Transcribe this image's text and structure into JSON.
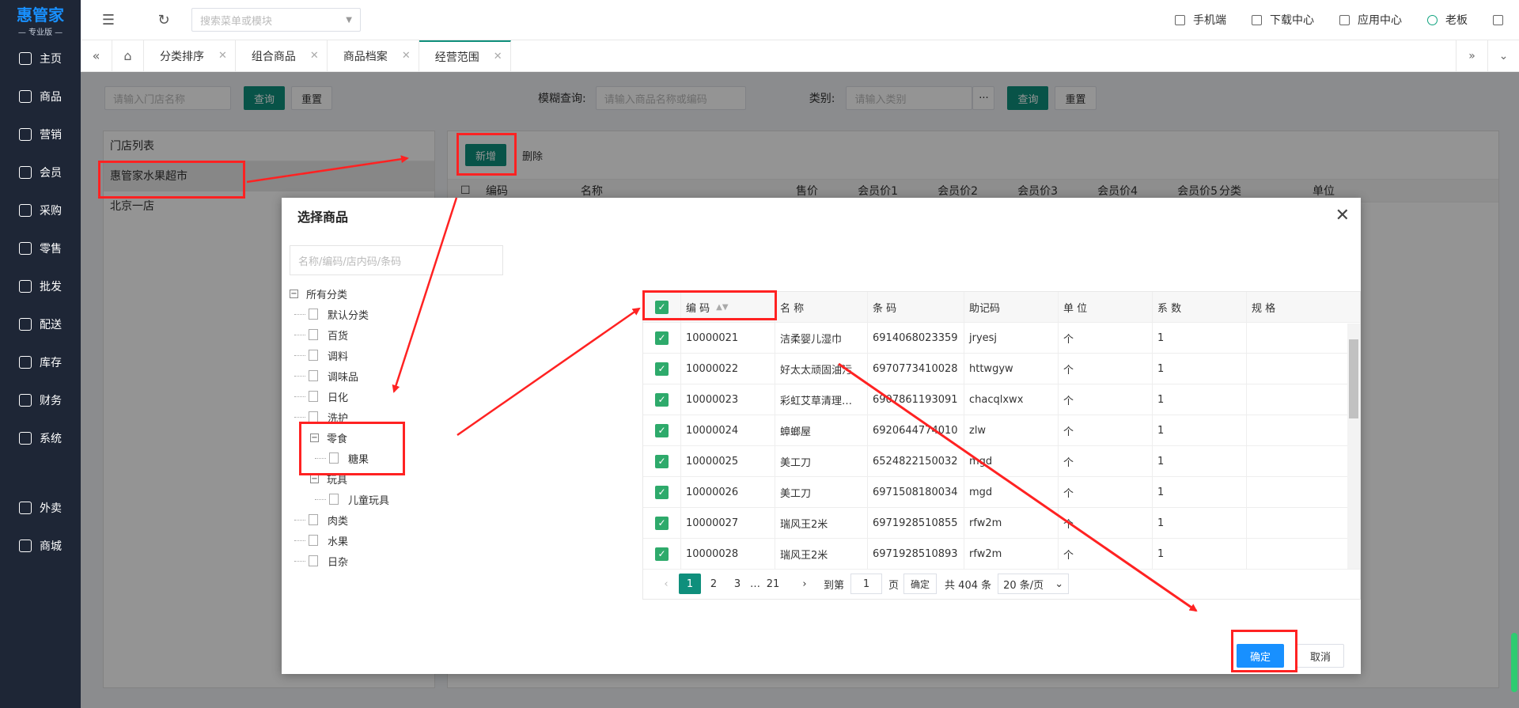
{
  "brand": {
    "name": "惠管家",
    "edition": "— 专业版 —",
    "color": "#1890ff"
  },
  "sidebar": {
    "items": [
      {
        "label": "主页",
        "icon": "home-icon"
      },
      {
        "label": "商品",
        "icon": "box-icon"
      },
      {
        "label": "营销",
        "icon": "chart-icon"
      },
      {
        "label": "会员",
        "icon": "heart-icon"
      },
      {
        "label": "采购",
        "icon": "cart-icon"
      },
      {
        "label": "零售",
        "icon": "bag-icon"
      },
      {
        "label": "批发",
        "icon": "stack-icon"
      },
      {
        "label": "配送",
        "icon": "truck-icon"
      },
      {
        "label": "库存",
        "icon": "warehouse-icon"
      },
      {
        "label": "财务",
        "icon": "finance-icon"
      },
      {
        "label": "系统",
        "icon": "settings-icon"
      },
      {
        "label": "外卖",
        "icon": "delivery-icon"
      },
      {
        "label": "商城",
        "icon": "shop-icon"
      }
    ]
  },
  "topbar": {
    "search_placeholder": "搜索菜单或模块",
    "mobile": "手机端",
    "download": "下载中心",
    "apps": "应用中心",
    "user": "老板"
  },
  "tabs": [
    {
      "label": "分类排序"
    },
    {
      "label": "组合商品"
    },
    {
      "label": "商品档案"
    },
    {
      "label": "经营范围",
      "active": true
    }
  ],
  "filters": {
    "store_placeholder": "请输入门店名称",
    "query": "查询",
    "reset": "重置",
    "fuzzy_label": "模糊查询:",
    "fuzzy_placeholder": "请输入商品名称或编码",
    "category_label": "类别:",
    "category_placeholder": "请输入类别",
    "more": "···"
  },
  "store_list": {
    "title": "门店列表",
    "items": [
      "惠管家水果超市",
      "北京一店"
    ]
  },
  "right_panel": {
    "add": "新增",
    "delete": "删除",
    "columns": [
      "编码",
      "名称",
      "售价",
      "会员价1",
      "会员价2",
      "会员价3",
      "会员价4",
      "会员价5",
      "分类",
      "单位"
    ]
  },
  "modal": {
    "title": "选择商品",
    "search_placeholder": "名称/编码/店内码/条码",
    "tree": {
      "root": "所有分类",
      "nodes": [
        {
          "label": "默认分类",
          "level": 1
        },
        {
          "label": "百货",
          "level": 1
        },
        {
          "label": "调料",
          "level": 1
        },
        {
          "label": "调味品",
          "level": 1
        },
        {
          "label": "日化",
          "level": 1
        },
        {
          "label": "洗护",
          "level": 1
        },
        {
          "label": "零食",
          "level": 1,
          "expanded": true
        },
        {
          "label": "糖果",
          "level": 2
        },
        {
          "label": "玩具",
          "level": 1,
          "expanded": true
        },
        {
          "label": "儿童玩具",
          "level": 2
        },
        {
          "label": "肉类",
          "level": 1
        },
        {
          "label": "水果",
          "level": 1
        },
        {
          "label": "日杂",
          "level": 1
        }
      ]
    },
    "columns": [
      "编 码",
      "名 称",
      "条 码",
      "助记码",
      "单 位",
      "系 数",
      "规 格"
    ],
    "rows": [
      [
        "10000021",
        "洁柔婴儿湿巾",
        "6914068023359",
        "jryesj",
        "个",
        "1",
        ""
      ],
      [
        "10000022",
        "好太太顽固油污",
        "6970773410028",
        "httwgyw",
        "个",
        "1",
        ""
      ],
      [
        "10000023",
        "彩虹艾草清理…",
        "6907861193091",
        "chacqlxwx",
        "个",
        "1",
        ""
      ],
      [
        "10000024",
        "蟑螂屋",
        "6920644774010",
        "zlw",
        "个",
        "1",
        ""
      ],
      [
        "10000025",
        "美工刀",
        "6524822150032",
        "mgd",
        "个",
        "1",
        ""
      ],
      [
        "10000026",
        "美工刀",
        "6971508180034",
        "mgd",
        "个",
        "1",
        ""
      ],
      [
        "10000027",
        "瑞风王2米",
        "6971928510855",
        "rfw2m",
        "个",
        "1",
        ""
      ],
      [
        "10000028",
        "瑞风王2米",
        "6971928510893",
        "rfw2m",
        "个",
        "1",
        ""
      ]
    ],
    "pager": {
      "pages": [
        "1",
        "2",
        "3",
        "…",
        "21"
      ],
      "goto_label": "到第",
      "goto_value": "1",
      "page_unit": "页",
      "confirm": "确定",
      "total": "共 404 条",
      "page_size": "20 条/页"
    },
    "ok": "确定",
    "cancel": "取消"
  },
  "colors": {
    "teal": "#0f8f7c",
    "check": "#2eaa6b",
    "primary": "#1890ff",
    "highlight": "#ff2222"
  }
}
